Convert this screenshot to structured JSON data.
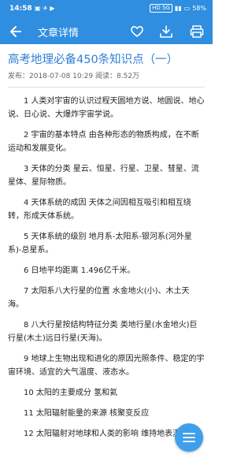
{
  "status_bar": {
    "time": "14:58",
    "network": "HD 5G",
    "battery": "58%"
  },
  "appbar": {
    "title": "文章详情"
  },
  "article": {
    "title": "高考地理必备450条知识点（一）",
    "meta": "发布：2018-07-08 10:29 阅读：8.52万",
    "paragraphs": [
      "1 人类对宇宙的认识过程天圆地方说、地圆说、地心说、日心说、大爆炸宇宙学说。",
      "2 宇宙的基本特点 由各种形态的物质构成，在不断运动和发展变化。",
      "3 天体的分类 星云、恒星、行星、卫星、彗星、流星体、星际物质。",
      "4 天体系统的成因 天体之间因相互吸引和相互绕转，形成天体系统。",
      "5 天体系统的级别 地月系-太阳系-银河系(河外星系)-总星系。",
      "6 日地平均距离 1.496亿千米。",
      "7 太阳系八大行星的位置 水金地火(小)、木土天海。",
      "8 八大行星按结构特征分类 类地行星(水金地火)巨行星(木土)远日行星(天海)。",
      "9 地球上生物出现和进化的原因光照条件、稳定的宇宙环境、适宜的大气温度、液态水。",
      "10 太阳的主要成分 氢和氦",
      "11 太阳辐射能量的来源 核聚变反应",
      "12 太阳辐射对地球和人类的影响 维持地表温"
    ]
  },
  "colors": {
    "primary": "#2f8ee0",
    "title_blue": "#2f7fd4",
    "fab": "#3ea0ea"
  }
}
